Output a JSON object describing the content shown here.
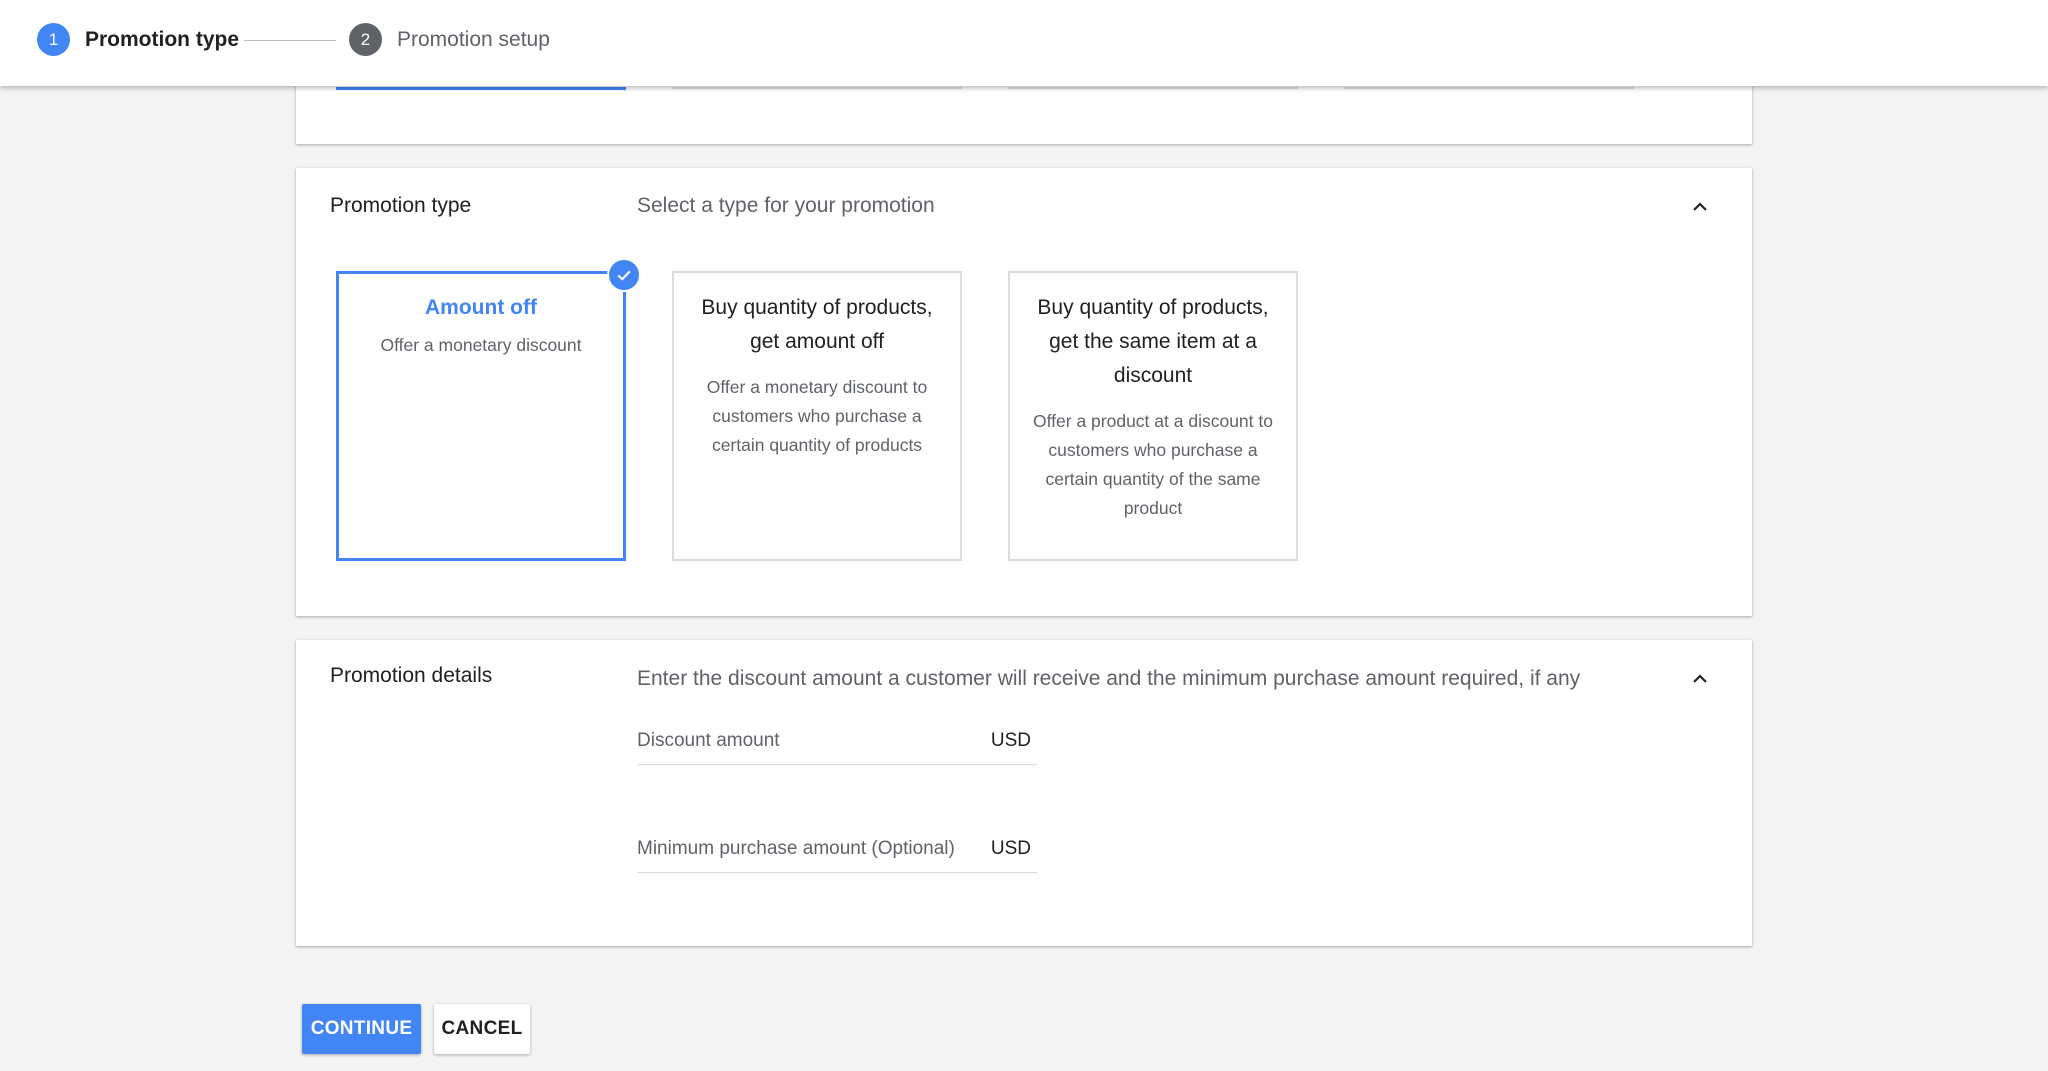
{
  "stepper": {
    "steps": [
      {
        "number": "1",
        "label": "Promotion type"
      },
      {
        "number": "2",
        "label": "Promotion setup"
      }
    ]
  },
  "promotion_type": {
    "title": "Promotion type",
    "subtitle": "Select a type for your promotion",
    "options": [
      {
        "title": "Amount off",
        "description": "Offer a monetary discount",
        "selected": true
      },
      {
        "title": "Buy quantity of products, get amount off",
        "description": "Offer a monetary discount to customers who purchase a certain quantity of products",
        "selected": false
      },
      {
        "title": "Buy quantity of products, get the same item at a discount",
        "description": "Offer a product at a discount to customers who purchase a certain quantity of the same product",
        "selected": false
      }
    ]
  },
  "promotion_details": {
    "title": "Promotion details",
    "subtitle": "Enter the discount amount a customer will receive and the minimum purchase amount required, if any",
    "fields": [
      {
        "label": "Discount amount",
        "suffix": "USD",
        "value": ""
      },
      {
        "label": "Minimum purchase amount (Optional)",
        "suffix": "USD",
        "value": ""
      }
    ]
  },
  "actions": {
    "continue_label": "CONTINUE",
    "cancel_label": "CANCEL"
  },
  "colors": {
    "accent": "#4285f4",
    "step_inactive": "#5f6368",
    "background": "#f4f4f4"
  },
  "icons": {
    "check": "check-circle-icon",
    "collapse": "chevron-up-icon"
  }
}
